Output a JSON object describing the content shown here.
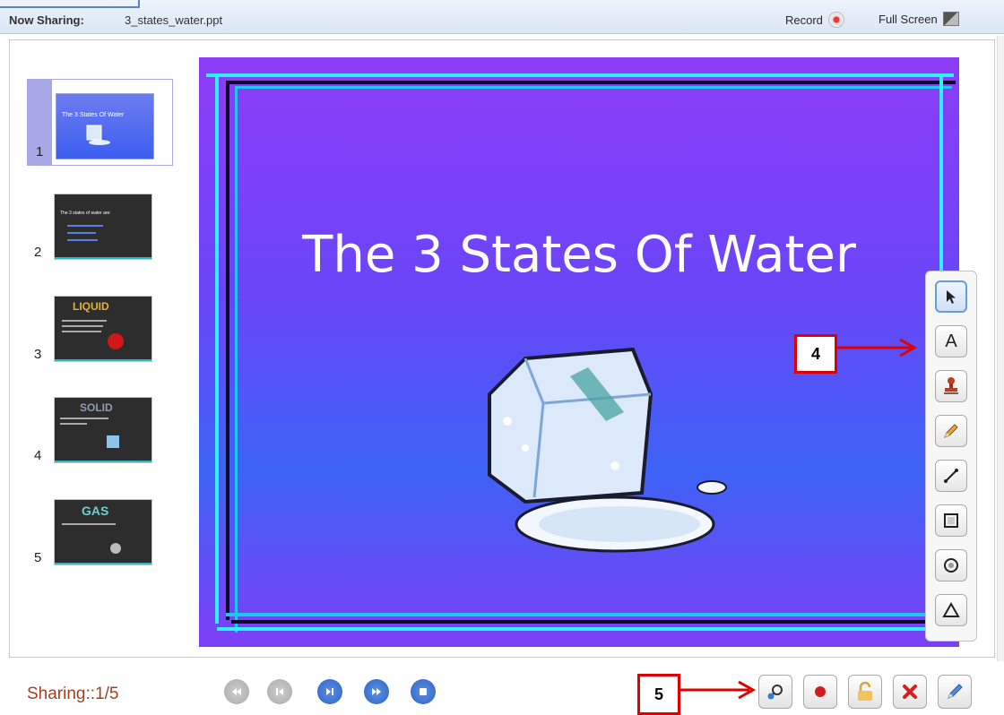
{
  "header": {
    "now_sharing_label": "Now Sharing:",
    "file_name": "3_states_water.ppt",
    "record_label": "Record",
    "fullscreen_label": "Full Screen"
  },
  "thumbnails": [
    {
      "number": "1",
      "title": "The 3 States Of Water",
      "selected": true
    },
    {
      "number": "2",
      "title": "The 3 states of water are:",
      "selected": false
    },
    {
      "number": "3",
      "title": "LIQUID",
      "selected": false
    },
    {
      "number": "4",
      "title": "SOLID",
      "selected": false
    },
    {
      "number": "5",
      "title": "GAS",
      "selected": false
    }
  ],
  "slide": {
    "title": "The 3 States Of Water",
    "image": "ice-cube-icon"
  },
  "drawing_tools": [
    {
      "name": "pointer-icon"
    },
    {
      "name": "text-icon"
    },
    {
      "name": "stamp-icon"
    },
    {
      "name": "pencil-icon"
    },
    {
      "name": "line-icon"
    },
    {
      "name": "rectangle-icon"
    },
    {
      "name": "circle-icon"
    },
    {
      "name": "triangle-icon"
    }
  ],
  "callouts": {
    "tools": "4",
    "actions": "5"
  },
  "footer": {
    "sharing_status": "Sharing::1/5",
    "nav": [
      "first-icon",
      "previous-icon",
      "next-icon",
      "last-icon",
      "stop-icon"
    ],
    "actions": [
      "zoom-search-icon",
      "record-icon",
      "lock-icon",
      "close-icon",
      "edit-icon"
    ]
  },
  "colors": {
    "accent": "#2f64c6",
    "callout": "#e00000",
    "slide_bg": "#6a45f8",
    "status_text": "#a5401e"
  }
}
